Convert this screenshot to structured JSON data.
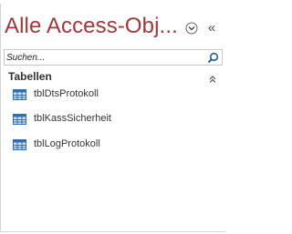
{
  "pane": {
    "title": "Alle Access-Obj...",
    "title_color": "#a4373a",
    "menu_icon": "circle-chevron-down-icon",
    "collapse_label": "«",
    "collapse_icon": "double-chevron-left-icon"
  },
  "search": {
    "placeholder": "Suchen...",
    "value": "",
    "icon": "search-icon"
  },
  "groups": [
    {
      "label": "Tabellen",
      "collapse_icon": "double-chevron-up-icon",
      "items": [
        {
          "label": "tblDtsProtokoll",
          "icon": "table-icon"
        },
        {
          "label": "tblKassSicherheit",
          "icon": "table-icon"
        },
        {
          "label": "tblLogProtokoll",
          "icon": "table-icon"
        }
      ]
    }
  ]
}
